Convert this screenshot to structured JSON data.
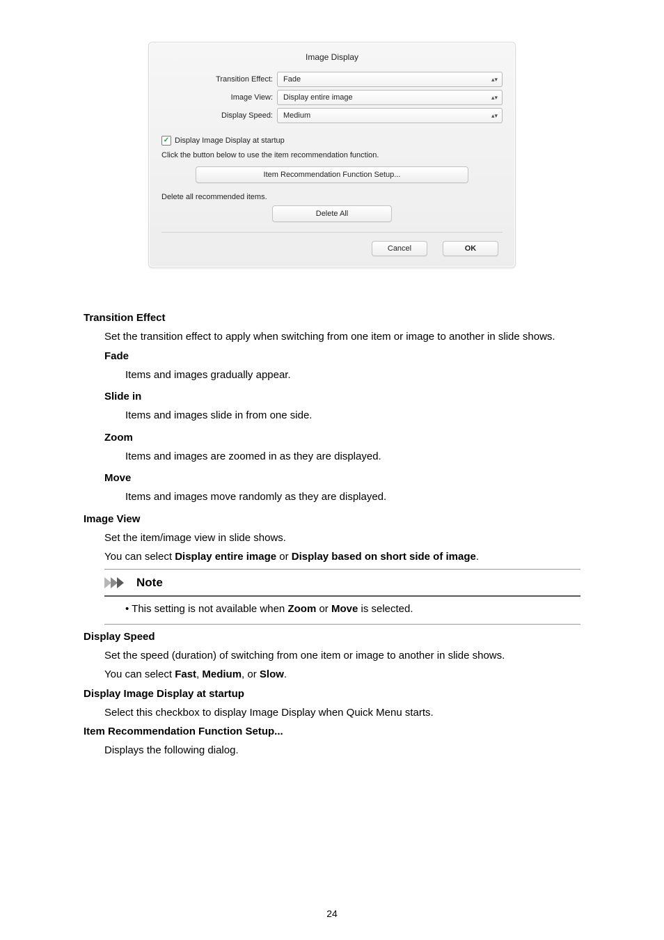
{
  "dialog": {
    "title": "Image Display",
    "fields": {
      "transition_label": "Transition Effect:",
      "transition_value": "Fade",
      "imageview_label": "Image View:",
      "imageview_value": "Display entire image",
      "speed_label": "Display Speed:",
      "speed_value": "Medium"
    },
    "checkbox_label": "Display Image Display at startup",
    "hint": "Click the button below to use the item recommendation function.",
    "item_setup_btn": "Item Recommendation Function Setup...",
    "delete_text": "Delete all recommended items.",
    "delete_btn": "Delete All",
    "cancel": "Cancel",
    "ok": "OK"
  },
  "doc": {
    "te_h": "Transition Effect",
    "te_b": "Set the transition effect to apply when switching from one item or image to another in slide shows.",
    "fade_h": "Fade",
    "fade_b": "Items and images gradually appear.",
    "slide_h": "Slide in",
    "slide_b": "Items and images slide in from one side.",
    "zoom_h": "Zoom",
    "zoom_b": "Items and images are zoomed in as they are displayed.",
    "move_h": "Move",
    "move_b": "Items and images move randomly as they are displayed.",
    "iv_h": "Image View",
    "iv_b1": "Set the item/image view in slide shows.",
    "iv_b2a": "You can select ",
    "iv_b2b": "Display entire image",
    "iv_b2c": " or ",
    "iv_b2d": "Display based on short side of image",
    "iv_b2e": ".",
    "note_h": "Note",
    "note_a": "This setting is not available when ",
    "note_b": "Zoom",
    "note_c": " or ",
    "note_d": "Move",
    "note_e": " is selected.",
    "ds_h": "Display Speed",
    "ds_b1": "Set the speed (duration) of switching from one item or image to another in slide shows.",
    "ds_b2a": "You can select ",
    "ds_b2b": "Fast",
    "ds_b2c": ", ",
    "ds_b2d": "Medium",
    "ds_b2e": ", or ",
    "ds_b2f": "Slow",
    "ds_b2g": ".",
    "did_h": "Display Image Display at startup",
    "did_b": "Select this checkbox to display Image Display when Quick Menu starts.",
    "irf_h": "Item Recommendation Function Setup...",
    "irf_b": "Displays the following dialog."
  },
  "page_number": "24"
}
